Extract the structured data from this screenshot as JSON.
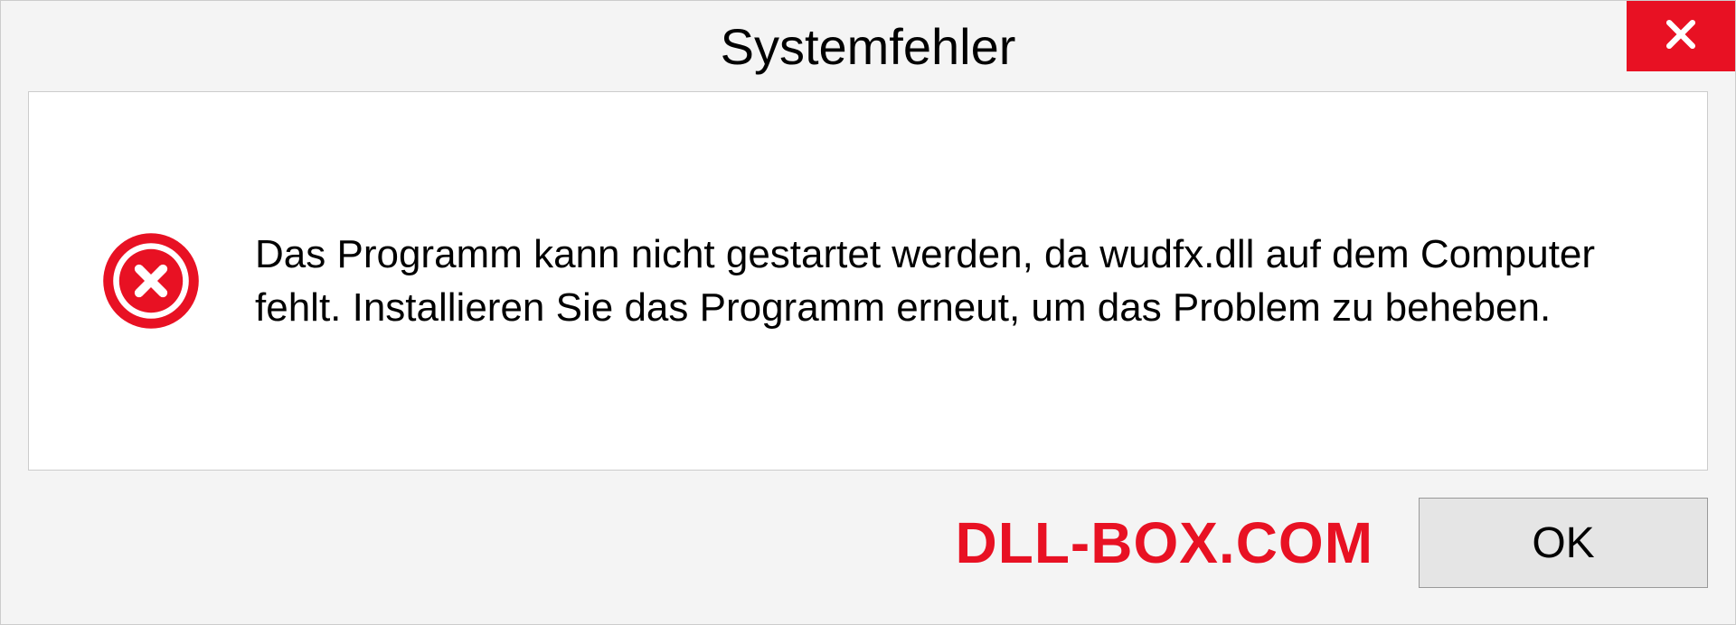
{
  "dialog": {
    "title": "Systemfehler",
    "message": "Das Programm kann nicht gestartet werden, da wudfx.dll auf dem Computer fehlt. Installieren Sie das Programm erneut, um das Problem zu beheben.",
    "ok_label": "OK"
  },
  "watermark": "DLL-BOX.COM"
}
